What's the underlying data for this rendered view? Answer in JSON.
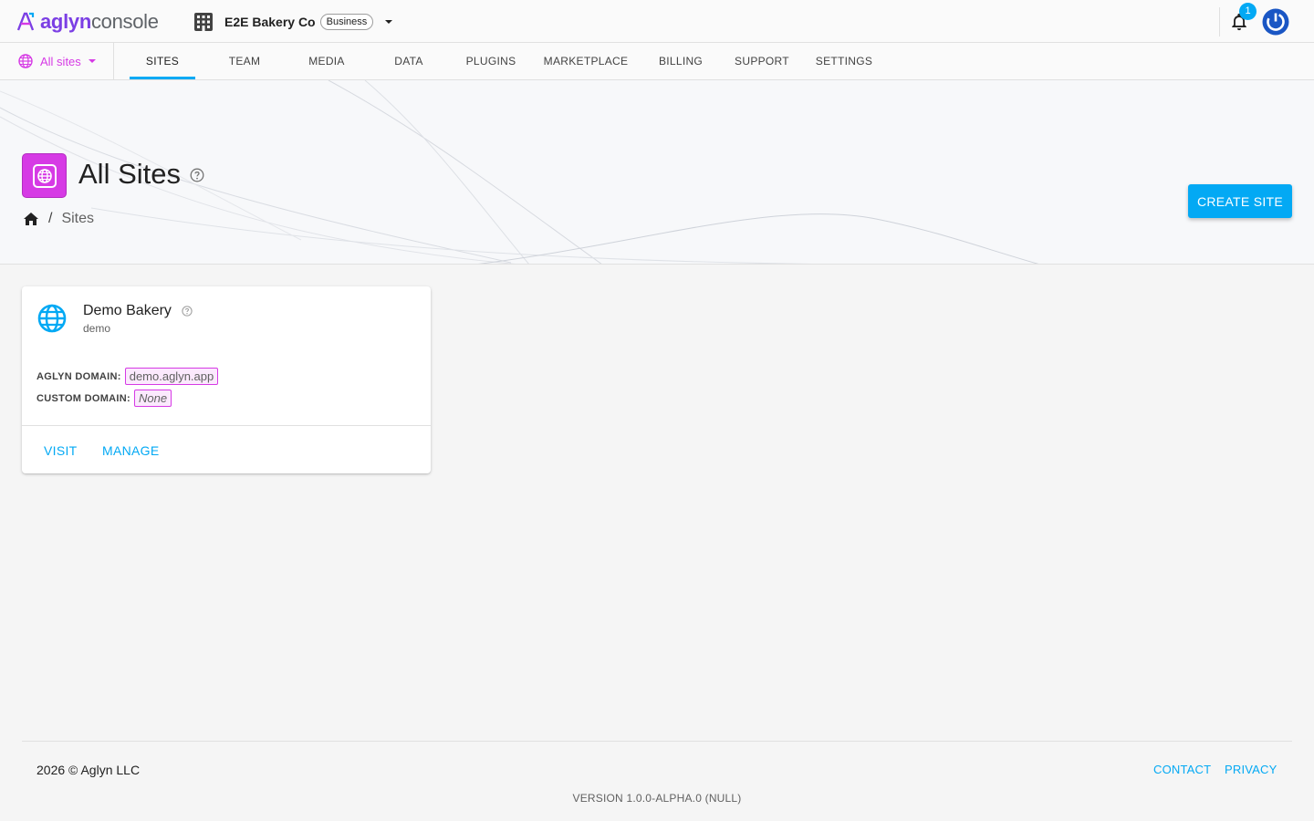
{
  "app": {
    "logo_brand": "aglyn",
    "logo_product": "console"
  },
  "org": {
    "name": "E2E Bakery Co",
    "plan": "Business"
  },
  "notifications": {
    "count": "1"
  },
  "site_selector": {
    "label": "All sites"
  },
  "nav": {
    "tabs": [
      "SITES",
      "TEAM",
      "MEDIA",
      "DATA",
      "PLUGINS",
      "MARKETPLACE",
      "BILLING",
      "SUPPORT",
      "SETTINGS"
    ],
    "active": "SITES"
  },
  "page": {
    "title": "All Sites",
    "breadcrumb_current": "Sites",
    "create_button": "CREATE SITE"
  },
  "sites": [
    {
      "name": "Demo Bakery",
      "slug": "demo",
      "aglyn_domain_label": "AGLYN DOMAIN:",
      "aglyn_domain": "demo.aglyn.app",
      "custom_domain_label": "CUSTOM DOMAIN:",
      "custom_domain": "None",
      "actions": [
        "VISIT",
        "MANAGE"
      ]
    }
  ],
  "footer": {
    "copyright": "2026 © Aglyn LLC",
    "links": [
      "CONTACT",
      "PRIVACY"
    ],
    "version": "VERSION 1.0.0-ALPHA.0 (NULL)"
  },
  "colors": {
    "accent_blue": "#03a9f4",
    "brand_magenta": "#d63ae5",
    "brand_purple": "#7b3fe4"
  }
}
